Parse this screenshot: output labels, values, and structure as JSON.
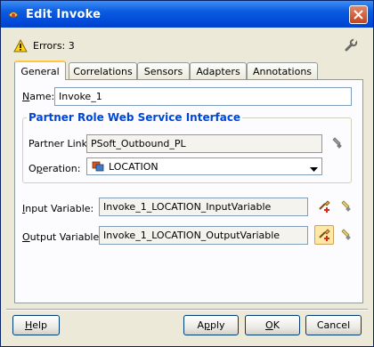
{
  "window": {
    "title": "Edit Invoke",
    "app_icon": "oracle-jdeveloper-icon",
    "close_icon": "close-icon"
  },
  "errors": {
    "label": "Errors: 3",
    "icon": "warning-icon"
  },
  "toolbar": {
    "wrench_icon": "wrench-icon"
  },
  "tabs": [
    {
      "label": "General",
      "active": true
    },
    {
      "label": "Correlations",
      "active": false
    },
    {
      "label": "Sensors",
      "active": false
    },
    {
      "label": "Adapters",
      "active": false
    },
    {
      "label": "Annotations",
      "active": false
    }
  ],
  "general": {
    "name_label_mnemonic": "N",
    "name_label_rest": "ame:",
    "name_value": "Invoke_1",
    "group_title": "Partner Role Web Service Interface",
    "partner_link_label": "Partner Link:",
    "partner_link_value": "PSoft_Outbound_PL",
    "operation_label_pre": "O",
    "operation_label_mnemonic": "p",
    "operation_label_rest": "eration:",
    "operation_value": "LOCATION",
    "input_label_mnemonic": "I",
    "input_label_rest": "nput Variable:",
    "input_value": "Invoke_1_LOCATION_InputVariable",
    "output_label_mnemonic": "O",
    "output_label_rest": "utput Variable:",
    "output_value": "Invoke_1_LOCATION_OutputVariable"
  },
  "buttons": {
    "help_mnemonic": "H",
    "help_rest": "elp",
    "apply_pre": "A",
    "apply_mnemonic": "p",
    "apply_rest": "ply",
    "ok_mnemonic": "O",
    "ok_rest": "K",
    "cancel": "Cancel"
  },
  "colors": {
    "title_bar": "#0a5ce0",
    "group_title": "#0046d5",
    "dialog_bg": "#ece9d8",
    "active_tab_accent": "#ffc83c"
  }
}
